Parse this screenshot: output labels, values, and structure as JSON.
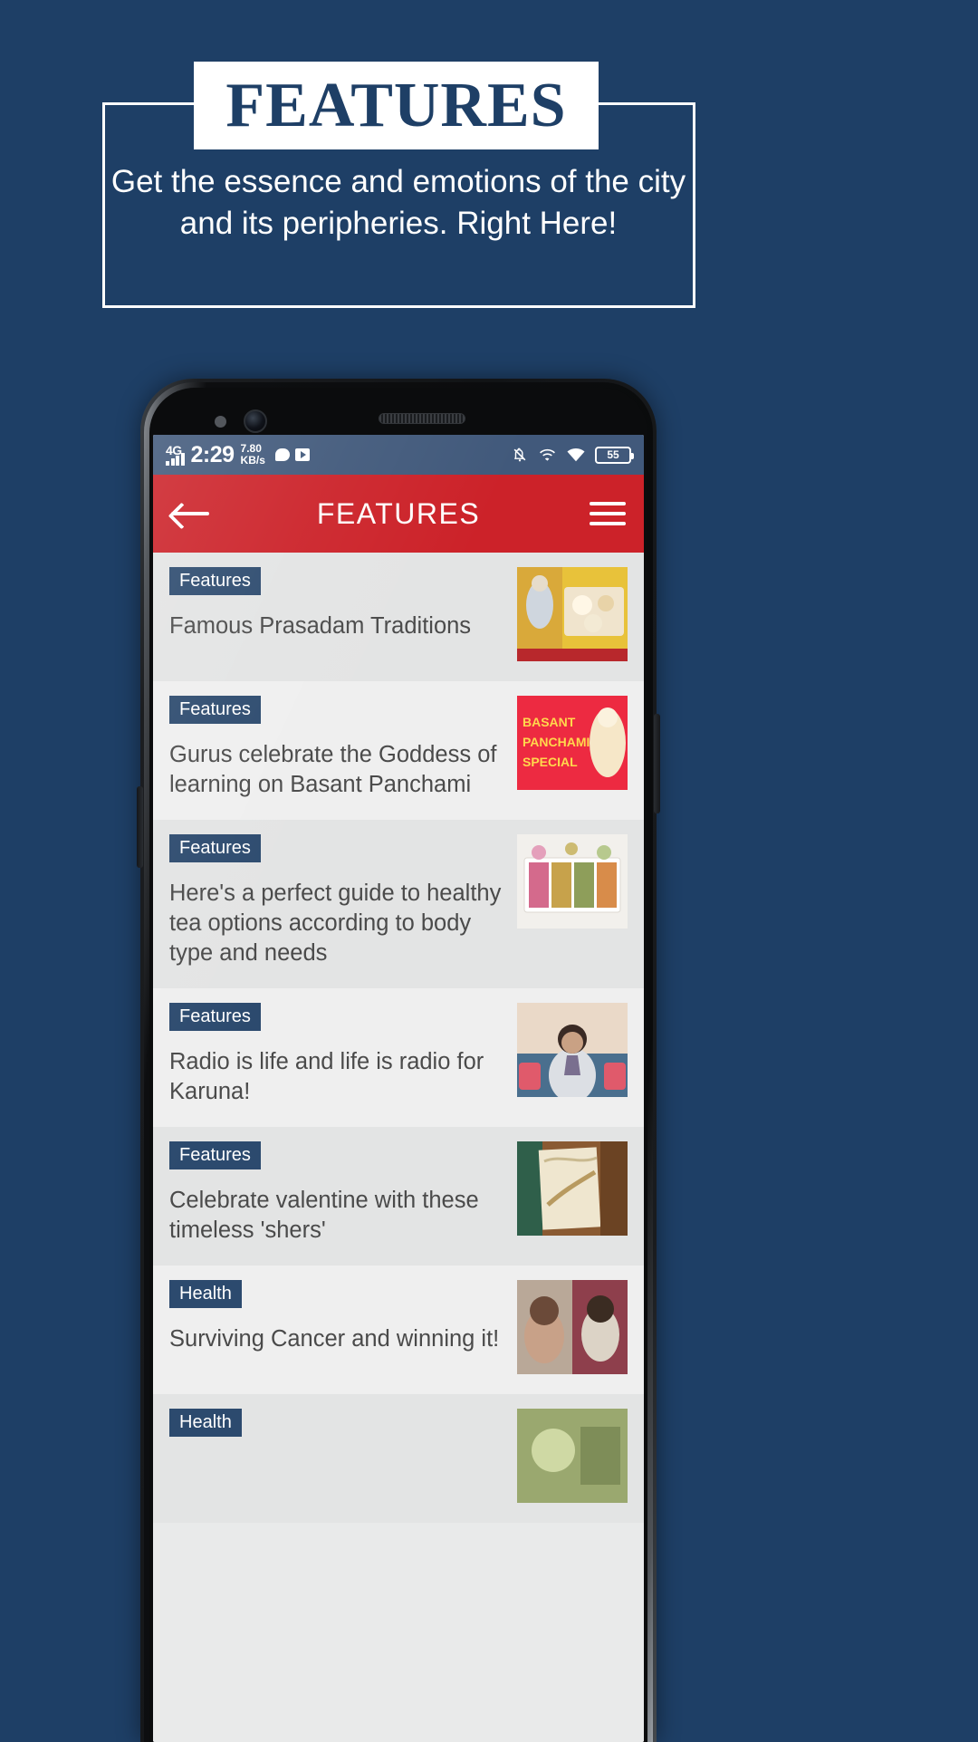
{
  "promo": {
    "title": "FEATURES",
    "subtitle": "Get the essence and emotions of the city and its peripheries. Right Here!",
    "accent_navy": "#1e3f66",
    "panel_white": "#ffffff"
  },
  "status_bar": {
    "network_type": "4G",
    "time": "2:29",
    "data_rate_value": "7.80",
    "data_rate_unit": "KB/s",
    "battery_percent": "55",
    "icons": [
      "signal-bars-icon",
      "chat-bubble-icon",
      "play-store-icon",
      "notifications-off-icon",
      "call-wifi-icon",
      "wifi-icon",
      "battery-icon"
    ],
    "background": "#41597b"
  },
  "app_bar": {
    "title": "FEATURES",
    "back_label": "back-arrow-icon",
    "menu_label": "hamburger-menu-icon",
    "background": "#cc2229"
  },
  "list": {
    "items": [
      {
        "badge": "Features",
        "title": "Famous Prasadam Traditions",
        "thumb": "prasadam-platter-photo"
      },
      {
        "badge": "Features",
        "title": "Gurus celebrate the Goddess of learning on Basant Panchami",
        "thumb": "basant-panchami-special-poster"
      },
      {
        "badge": "Features",
        "title": "Here's a perfect guide to healthy tea options according to body type and needs",
        "thumb": "herbal-tea-assortment-photo"
      },
      {
        "badge": "Features",
        "title": "Radio is life and life is radio for Karuna!",
        "thumb": "radio-host-portrait-photo"
      },
      {
        "badge": "Features",
        "title": "Celebrate valentine with these timeless 'shers'",
        "thumb": "quill-and-parchment-photo"
      },
      {
        "badge": "Health",
        "title": "Surviving Cancer and winning it!",
        "thumb": "cancer-survivors-photo"
      },
      {
        "badge": "Health",
        "title": "",
        "thumb": "health-article-photo"
      }
    ],
    "badge_color": "#2c4a6e",
    "title_color": "#4a4a4a"
  }
}
